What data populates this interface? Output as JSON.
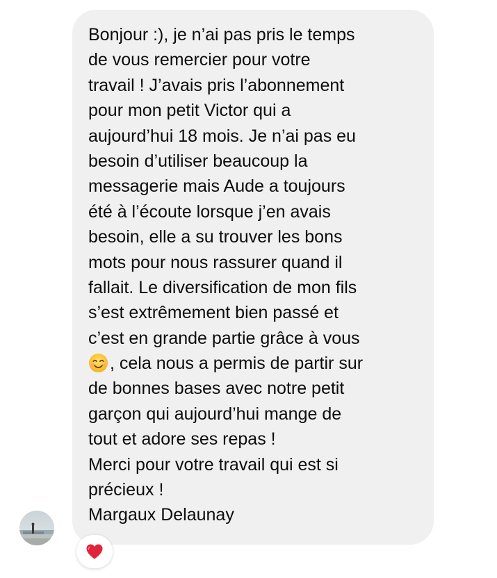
{
  "message": {
    "lines": [
      "Bonjour :), je n’ai pas pris le temps",
      "de vous remercier pour votre",
      "travail ! J’avais pris l’abonnement",
      "pour mon petit Victor qui a",
      "aujourd’hui 18 mois. Je n’ai pas eu",
      "besoin d’utiliser beaucoup la",
      "messagerie mais Aude a toujours",
      "été à l’écoute lorsque j’en avais",
      "besoin, elle a su trouver les bons",
      "mots pour nous rassurer quand il",
      "fallait. Le diversification de mon fils",
      "s’est extrêmement bien passé et",
      "c’est en grande partie grâce à vous",
      ", cela nous a permis de partir sur",
      "de bonnes bases avec notre petit",
      "garçon qui aujourd’hui mange de",
      "tout et adore ses repas !",
      "Merci pour votre travail qui est si",
      "précieux !",
      "Margaux Delaunay"
    ],
    "emoji_icon": "smiling-face-emoji",
    "bubble_color": "#f0f0f1",
    "text_color": "#0c0c0c"
  },
  "sender": {
    "avatar_icon": "profile-photo-avatar"
  },
  "reaction": {
    "icon": "red-heart-icon",
    "color": "#e0243a"
  }
}
